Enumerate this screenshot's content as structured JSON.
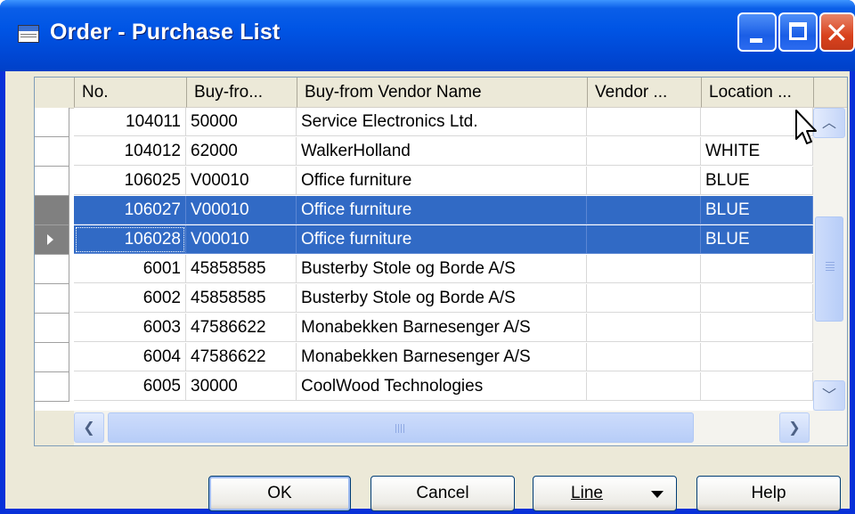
{
  "window": {
    "title": "Order - Purchase List",
    "controls": [
      "minimize-icon",
      "maximize-icon",
      "close-icon"
    ]
  },
  "table": {
    "columns": [
      "No.",
      "Buy-fro...",
      "Buy-from Vendor Name",
      "Vendor ...",
      "Location ..."
    ],
    "rows": [
      {
        "no": "104011",
        "buy_from": "50000",
        "vendor_name": "Service Electronics Ltd.",
        "vendor": "",
        "location": ""
      },
      {
        "no": "104012",
        "buy_from": "62000",
        "vendor_name": "WalkerHolland",
        "vendor": "",
        "location": "WHITE"
      },
      {
        "no": "106025",
        "buy_from": "V00010",
        "vendor_name": "Office furniture",
        "vendor": "",
        "location": "BLUE"
      },
      {
        "no": "106027",
        "buy_from": "V00010",
        "vendor_name": "Office furniture",
        "vendor": "",
        "location": "BLUE"
      },
      {
        "no": "106028",
        "buy_from": "V00010",
        "vendor_name": "Office furniture",
        "vendor": "",
        "location": "BLUE"
      },
      {
        "no": "6001",
        "buy_from": "45858585",
        "vendor_name": "Busterby Stole og Borde A/S",
        "vendor": "",
        "location": ""
      },
      {
        "no": "6002",
        "buy_from": "45858585",
        "vendor_name": "Busterby Stole og Borde A/S",
        "vendor": "",
        "location": ""
      },
      {
        "no": "6003",
        "buy_from": "47586622",
        "vendor_name": "Monabekken Barnesenger A/S",
        "vendor": "",
        "location": ""
      },
      {
        "no": "6004",
        "buy_from": "47586622",
        "vendor_name": "Monabekken Barnesenger A/S",
        "vendor": "",
        "location": ""
      },
      {
        "no": "6005",
        "buy_from": "30000",
        "vendor_name": "CoolWood Technologies",
        "vendor": "",
        "location": ""
      }
    ],
    "selected_rows": [
      3,
      4
    ],
    "current_row": 4
  },
  "buttons": {
    "ok": "OK",
    "cancel": "Cancel",
    "line": "Line",
    "help": "Help"
  },
  "colors": {
    "titlebar": "#0055e5",
    "selection": "#316ac5",
    "dialog_bg": "#ece9d8"
  }
}
